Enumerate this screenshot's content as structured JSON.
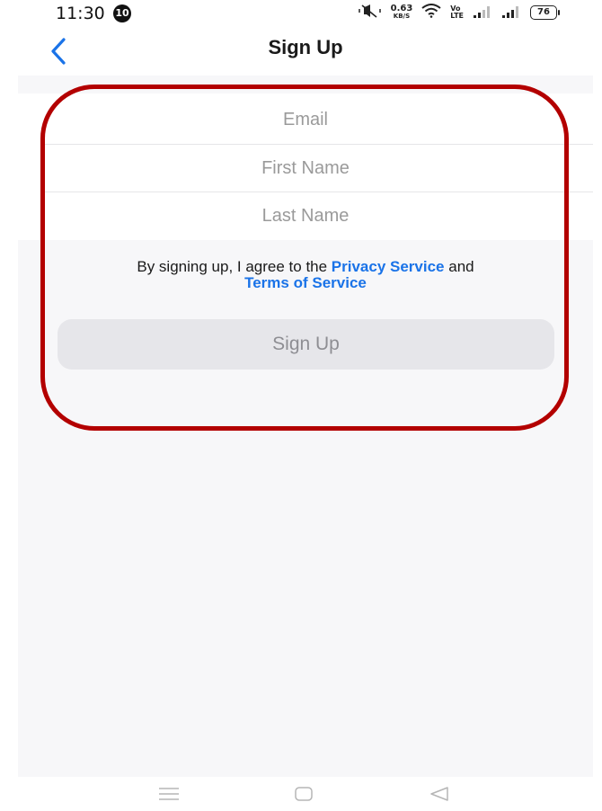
{
  "status_bar": {
    "time": "11:30",
    "notification_count": "10",
    "net_speed_value": "0.63",
    "net_speed_unit": "KB/S",
    "volte_top": "Vo",
    "volte_bottom": "LTE",
    "battery": "76"
  },
  "header": {
    "title": "Sign Up",
    "back_icon": "chevron-left-icon"
  },
  "form": {
    "email_placeholder": "Email",
    "first_name_placeholder": "First Name",
    "last_name_placeholder": "Last Name"
  },
  "agreement": {
    "prefix": "By signing up, I agree to the ",
    "privacy_link": "Privacy Service",
    "conjunction": " and",
    "terms_link": "Terms of Service"
  },
  "signup_button": {
    "label": "Sign Up"
  },
  "nav_bar": {
    "icons": [
      "menu-icon",
      "home-icon",
      "back-icon"
    ]
  },
  "colors": {
    "accent": "#1a73e8",
    "highlight": "#b30000",
    "button_bg": "#e6e6ea",
    "background": "#f7f7f9"
  }
}
